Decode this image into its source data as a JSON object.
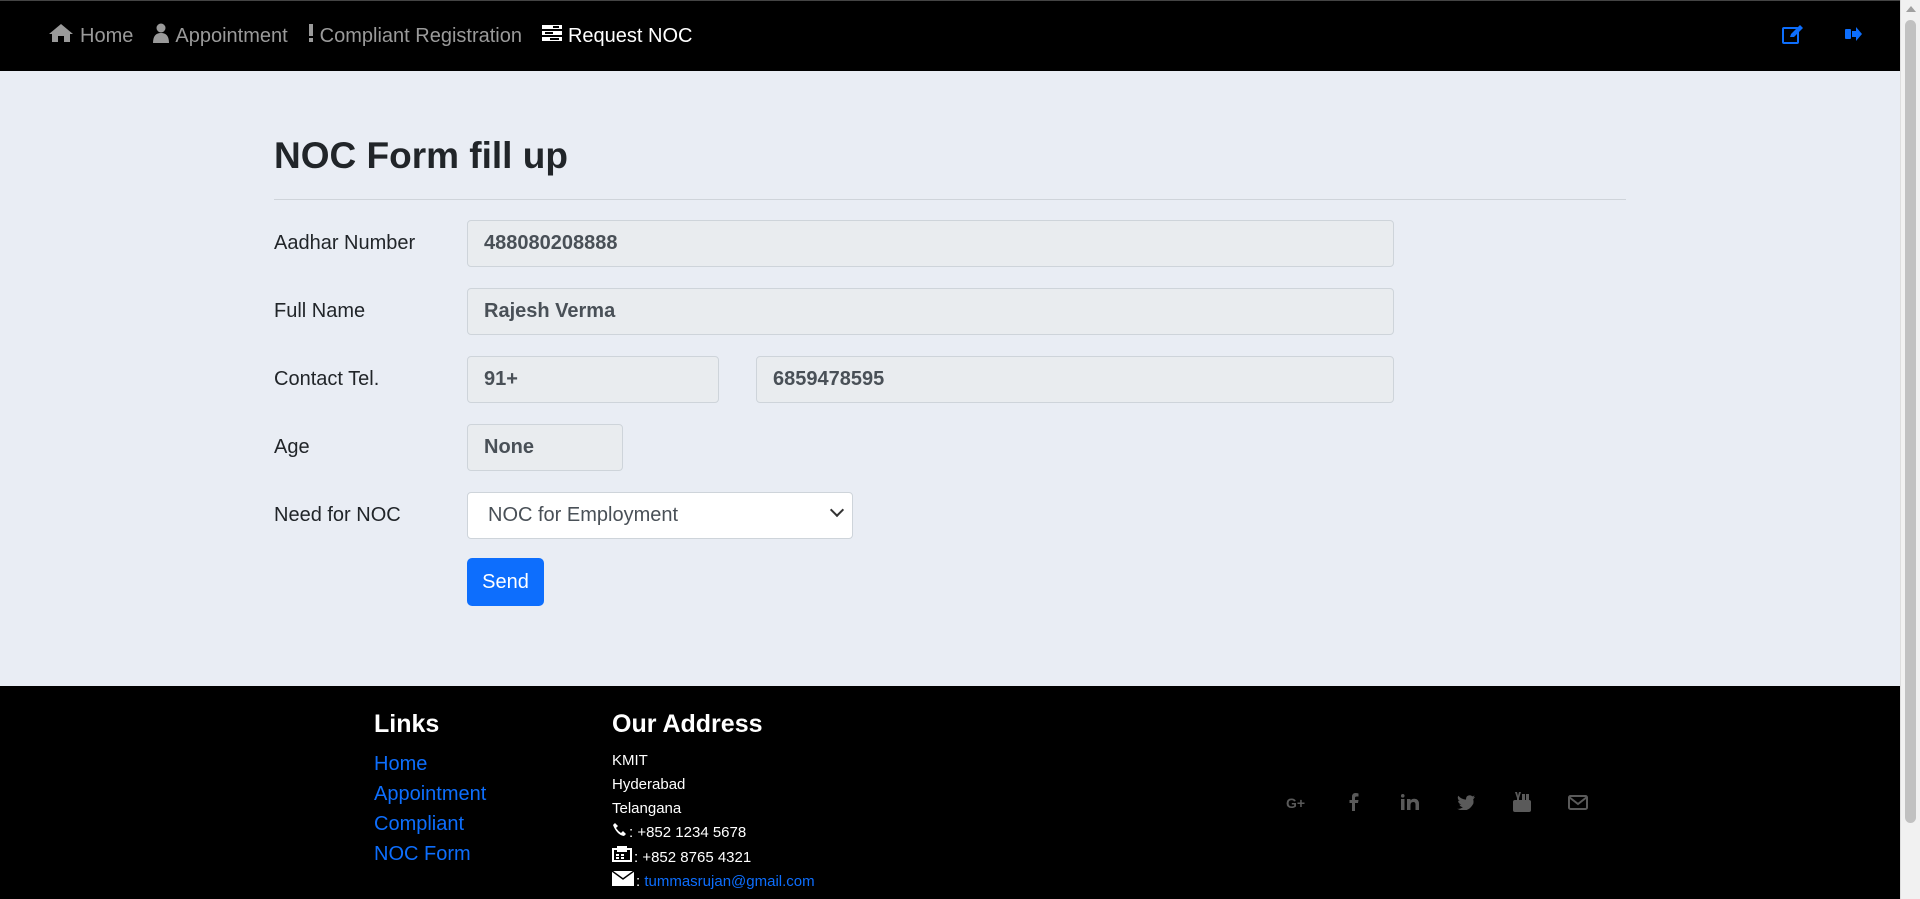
{
  "nav": {
    "items": [
      {
        "label": "Home",
        "icon": "home-icon"
      },
      {
        "label": "Appointment",
        "icon": "user-icon"
      },
      {
        "label": "Compliant Registration",
        "icon": "exclamation-icon"
      },
      {
        "label": "Request NOC",
        "icon": "tasks-icon",
        "active": true
      }
    ],
    "right_icons": [
      "edit-icon",
      "sign-out-icon"
    ]
  },
  "form": {
    "title": "NOC Form fill up",
    "aadhar_label": "Aadhar Number",
    "aadhar_value": "488080208888",
    "name_label": "Full Name",
    "name_value": "Rajesh Verma",
    "contact_label": "Contact Tel.",
    "country_code": "91+",
    "phone_value": "6859478595",
    "age_label": "Age",
    "age_value": "None",
    "noc_label": "Need for NOC",
    "noc_selected": "NOC for Employment",
    "send_label": "Send"
  },
  "footer": {
    "links_title": "Links",
    "links": [
      "Home",
      "Appointment",
      "Compliant",
      "NOC Form"
    ],
    "address_title": "Our Address",
    "address_lines": [
      "KMIT",
      "Hyderabad",
      "Telangana"
    ],
    "phone": ": +852 1234 5678",
    "fax": ": +852 8765 4321",
    "email_prefix": ":",
    "email": "tummasrujan@gmail.com",
    "social_icons": [
      "google-plus-icon",
      "facebook-icon",
      "linkedin-icon",
      "twitter-icon",
      "youtube-icon",
      "envelope-icon"
    ]
  },
  "colors": {
    "navbar_bg": "#000000",
    "page_bg": "#e9edf4",
    "accent": "#0d6efd",
    "footer_bg": "#000000"
  }
}
